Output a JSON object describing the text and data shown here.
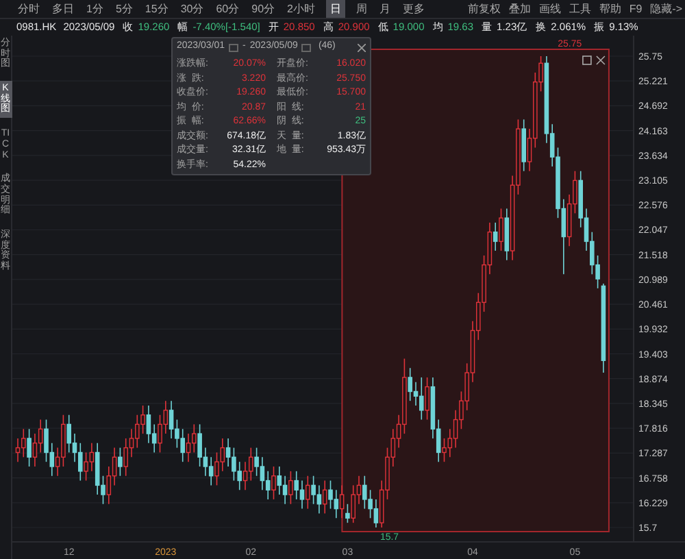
{
  "toolbar": {
    "periods": [
      {
        "label": "分时",
        "selected": false
      },
      {
        "label": "多日",
        "selected": false
      },
      {
        "label": "1分",
        "selected": false
      },
      {
        "label": "5分",
        "selected": false
      },
      {
        "label": "15分",
        "selected": false
      },
      {
        "label": "30分",
        "selected": false
      },
      {
        "label": "60分",
        "selected": false
      },
      {
        "label": "90分",
        "selected": false
      },
      {
        "label": "2小时",
        "selected": false
      },
      {
        "label": "日",
        "selected": true
      },
      {
        "label": "周",
        "selected": false
      },
      {
        "label": "月",
        "selected": false
      },
      {
        "label": "更多",
        "selected": false
      }
    ],
    "tools": [
      "前复权",
      "叠加",
      "画线",
      "工具",
      "帮助",
      "F9",
      "隐藏->"
    ]
  },
  "quote": {
    "code": "0981.HK",
    "date": "2023/05/09",
    "fields": [
      {
        "label": "收",
        "value": "19.260",
        "color": "#3fbf7f"
      },
      {
        "label": "幅",
        "value": "-7.40%[-1.540]",
        "color": "#3fbf7f"
      },
      {
        "label": "开",
        "value": "20.850",
        "color": "#e0333a"
      },
      {
        "label": "高",
        "value": "20.900",
        "color": "#e0333a"
      },
      {
        "label": "低",
        "value": "19.000",
        "color": "#3fbf7f"
      },
      {
        "label": "均",
        "value": "19.63",
        "color": "#3fbf7f"
      },
      {
        "label": "量",
        "value": "1.23亿",
        "color": "#e8e8e8"
      },
      {
        "label": "换",
        "value": "2.061%",
        "color": "#e8e8e8"
      },
      {
        "label": "振",
        "value": "9.13%",
        "color": "#e8e8e8"
      }
    ]
  },
  "sidebar": {
    "items": [
      {
        "label": "分时图",
        "selected": false
      },
      {
        "label": "K线图",
        "selected": true
      },
      {
        "label": "TICK",
        "selected": false
      },
      {
        "label": "成交明细",
        "selected": false
      },
      {
        "label": "深度资料",
        "selected": false
      }
    ]
  },
  "range_popup": {
    "start": "2023/03/01",
    "end": "2023/05/09",
    "separator": "-",
    "count": "(46)",
    "stats": [
      {
        "label": "涨跌幅:",
        "value": "20.07%",
        "color": "#e0333a"
      },
      {
        "label": "开盘价:",
        "value": "16.020",
        "color": "#e0333a"
      },
      {
        "label": "涨  跌:",
        "value": "3.220",
        "color": "#e0333a"
      },
      {
        "label": "最高价:",
        "value": "25.750",
        "color": "#e0333a"
      },
      {
        "label": "收盘价:",
        "value": "19.260",
        "color": "#e0333a"
      },
      {
        "label": "最低价:",
        "value": "15.700",
        "color": "#e0333a"
      },
      {
        "label": "均  价:",
        "value": "20.87",
        "color": "#e0333a"
      },
      {
        "label": "阳  线:",
        "value": "21",
        "color": "#e0333a"
      },
      {
        "label": "振  幅:",
        "value": "62.66%",
        "color": "#e0333a"
      },
      {
        "label": "阴  线:",
        "value": "25",
        "color": "#3fbf7f"
      },
      {
        "label": "成交额:",
        "value": "674.18亿",
        "color": "#f0f0f0"
      },
      {
        "label": "天  量:",
        "value": "1.83亿",
        "color": "#f0f0f0"
      },
      {
        "label": "成交量:",
        "value": "32.31亿",
        "color": "#f0f0f0"
      },
      {
        "label": "地  量:",
        "value": "953.43万",
        "color": "#f0f0f0"
      },
      {
        "label": "换手率:",
        "value": "54.22%",
        "color": "#f0f0f0"
      }
    ]
  },
  "chart": {
    "high_marker": "25.75",
    "low_marker": "15.7",
    "x_labels": [
      {
        "color": "#9a9a9a"
      },
      {
        "color": "#d9953a"
      },
      {
        "color": "#9a9a9a"
      },
      {
        "color": "#9a9a9a"
      },
      {
        "color": "#9a9a9a"
      },
      {
        "color": "#9a9a9a"
      }
    ],
    "chart_data": {
      "type": "candlestick",
      "grid": true,
      "ylim": [
        15.7,
        25.75
      ],
      "categories": [
        null,
        null,
        null,
        null,
        null,
        null,
        null,
        null,
        null,
        "12",
        null,
        null,
        null,
        null,
        null,
        null,
        null,
        null,
        null,
        null,
        null,
        null,
        null,
        null,
        null,
        null,
        "2023",
        null,
        null,
        null,
        null,
        null,
        null,
        null,
        null,
        null,
        null,
        null,
        null,
        null,
        null,
        "02",
        null,
        null,
        null,
        null,
        null,
        null,
        null,
        null,
        null,
        null,
        null,
        null,
        null,
        null,
        null,
        null,
        "03",
        null,
        null,
        null,
        null,
        null,
        null,
        null,
        null,
        null,
        null,
        null,
        null,
        null,
        null,
        null,
        null,
        null,
        null,
        null,
        null,
        null,
        "04",
        null,
        null,
        null,
        null,
        null,
        null,
        null,
        null,
        null,
        null,
        null,
        null,
        null,
        null,
        null,
        null,
        null,
        "05",
        null,
        null,
        null,
        null,
        null
      ],
      "yticks": [
        25.75,
        25.221,
        24.692,
        24.163,
        23.634,
        23.105,
        22.576,
        22.047,
        21.518,
        20.989,
        20.461,
        19.932,
        19.403,
        18.874,
        18.345,
        17.816,
        17.287,
        16.758,
        16.229,
        15.7
      ],
      "ohlc": [
        [
          17.3,
          17.6,
          17.1,
          17.4
        ],
        [
          17.4,
          17.8,
          17.2,
          17.6
        ],
        [
          17.6,
          17.8,
          17.0,
          17.2
        ],
        [
          17.2,
          17.7,
          17.0,
          17.5
        ],
        [
          17.5,
          18.0,
          17.3,
          17.8
        ],
        [
          17.8,
          18.0,
          17.1,
          17.3
        ],
        [
          17.3,
          17.5,
          16.8,
          17.0
        ],
        [
          17.0,
          17.4,
          16.8,
          17.2
        ],
        [
          17.2,
          18.1,
          17.0,
          17.9
        ],
        [
          17.9,
          18.1,
          17.3,
          17.5
        ],
        [
          17.5,
          17.7,
          17.1,
          17.3
        ],
        [
          17.3,
          17.5,
          16.7,
          16.9
        ],
        [
          16.9,
          17.3,
          16.7,
          17.1
        ],
        [
          17.1,
          17.5,
          16.9,
          17.3
        ],
        [
          17.3,
          17.5,
          16.4,
          16.6
        ],
        [
          16.6,
          16.8,
          16.2,
          16.4
        ],
        [
          16.4,
          17.0,
          16.2,
          16.8
        ],
        [
          16.8,
          17.4,
          16.6,
          17.2
        ],
        [
          17.2,
          17.4,
          16.8,
          17.0
        ],
        [
          17.0,
          17.6,
          16.8,
          17.4
        ],
        [
          17.4,
          17.8,
          17.2,
          17.6
        ],
        [
          17.6,
          18.1,
          17.4,
          17.9
        ],
        [
          17.9,
          18.3,
          17.7,
          18.1
        ],
        [
          18.1,
          18.3,
          17.5,
          17.7
        ],
        [
          17.7,
          17.9,
          17.3,
          17.5
        ],
        [
          17.5,
          18.1,
          17.3,
          17.9
        ],
        [
          17.9,
          18.4,
          17.7,
          18.2
        ],
        [
          18.2,
          18.4,
          17.6,
          17.8
        ],
        [
          17.8,
          18.0,
          17.4,
          17.6
        ],
        [
          17.6,
          17.8,
          17.1,
          17.3
        ],
        [
          17.3,
          17.7,
          17.1,
          17.5
        ],
        [
          17.5,
          17.9,
          17.3,
          17.7
        ],
        [
          17.7,
          17.9,
          17.0,
          17.2
        ],
        [
          17.2,
          17.4,
          16.8,
          17.0
        ],
        [
          17.0,
          17.2,
          16.6,
          16.8
        ],
        [
          16.8,
          17.3,
          16.6,
          17.1
        ],
        [
          17.1,
          17.6,
          16.9,
          17.4
        ],
        [
          17.4,
          17.6,
          17.0,
          17.2
        ],
        [
          17.2,
          17.4,
          16.7,
          16.9
        ],
        [
          16.9,
          17.1,
          16.5,
          16.7
        ],
        [
          16.7,
          17.1,
          16.5,
          16.9
        ],
        [
          16.9,
          17.4,
          16.7,
          17.2
        ],
        [
          17.2,
          17.4,
          16.8,
          17.0
        ],
        [
          17.0,
          17.2,
          16.5,
          16.7
        ],
        [
          16.7,
          16.9,
          16.3,
          16.5
        ],
        [
          16.5,
          17.0,
          16.3,
          16.8
        ],
        [
          16.8,
          17.0,
          16.4,
          16.6
        ],
        [
          16.6,
          16.8,
          16.2,
          16.4
        ],
        [
          16.4,
          16.9,
          16.2,
          16.7
        ],
        [
          16.7,
          16.9,
          16.3,
          16.5
        ],
        [
          16.5,
          16.7,
          16.1,
          16.3
        ],
        [
          16.3,
          16.8,
          16.1,
          16.6
        ],
        [
          16.6,
          16.8,
          16.2,
          16.4
        ],
        [
          16.4,
          16.6,
          16.0,
          16.2
        ],
        [
          16.2,
          16.7,
          16.0,
          16.5
        ],
        [
          16.5,
          16.7,
          16.1,
          16.3
        ],
        [
          16.3,
          16.5,
          15.9,
          16.1
        ],
        [
          16.1,
          16.6,
          15.9,
          16.4
        ],
        [
          16.0,
          16.2,
          15.8,
          15.9
        ],
        [
          15.9,
          16.6,
          15.8,
          16.4
        ],
        [
          16.4,
          16.8,
          16.2,
          16.6
        ],
        [
          16.6,
          16.8,
          16.1,
          16.3
        ],
        [
          16.3,
          16.5,
          15.9,
          16.1
        ],
        [
          16.1,
          16.3,
          15.7,
          15.8
        ],
        [
          15.8,
          16.7,
          15.7,
          16.5
        ],
        [
          16.5,
          17.4,
          16.3,
          17.2
        ],
        [
          17.2,
          17.8,
          17.0,
          17.6
        ],
        [
          17.6,
          18.1,
          17.4,
          17.9
        ],
        [
          17.9,
          19.3,
          17.7,
          18.9
        ],
        [
          18.9,
          19.1,
          18.4,
          18.6
        ],
        [
          18.6,
          18.8,
          18.3,
          18.5
        ],
        [
          18.5,
          18.9,
          18.0,
          18.2
        ],
        [
          18.2,
          18.9,
          18.0,
          18.7
        ],
        [
          18.7,
          18.9,
          17.6,
          17.8
        ],
        [
          17.8,
          18.0,
          17.1,
          17.3
        ],
        [
          17.3,
          17.6,
          17.1,
          17.4
        ],
        [
          17.4,
          17.8,
          17.2,
          17.6
        ],
        [
          17.6,
          18.2,
          17.4,
          18.0
        ],
        [
          18.0,
          18.6,
          17.8,
          18.4
        ],
        [
          18.4,
          19.2,
          18.2,
          19.0
        ],
        [
          19.0,
          20.1,
          18.8,
          19.9
        ],
        [
          19.9,
          20.7,
          19.7,
          20.5
        ],
        [
          20.5,
          21.5,
          20.3,
          21.3
        ],
        [
          21.3,
          22.2,
          21.1,
          22.0
        ],
        [
          22.0,
          22.2,
          21.6,
          21.8
        ],
        [
          21.8,
          22.5,
          21.6,
          22.3
        ],
        [
          22.3,
          22.5,
          21.4,
          21.6
        ],
        [
          21.6,
          23.2,
          21.4,
          23.0
        ],
        [
          23.0,
          24.4,
          22.8,
          24.2
        ],
        [
          24.2,
          24.4,
          23.3,
          23.5
        ],
        [
          23.5,
          24.2,
          23.3,
          24.0
        ],
        [
          24.0,
          25.4,
          23.8,
          25.2
        ],
        [
          25.2,
          25.75,
          25.0,
          25.6
        ],
        [
          25.6,
          25.75,
          23.9,
          24.1
        ],
        [
          24.1,
          24.3,
          23.4,
          23.6
        ],
        [
          23.6,
          23.8,
          22.3,
          22.5
        ],
        [
          22.5,
          22.7,
          21.1,
          21.9
        ],
        [
          21.9,
          22.8,
          21.7,
          22.6
        ],
        [
          22.6,
          23.3,
          22.4,
          23.1
        ],
        [
          23.1,
          23.3,
          22.1,
          22.3
        ],
        [
          22.3,
          22.5,
          21.6,
          21.8
        ],
        [
          21.8,
          22.0,
          21.1,
          21.3
        ],
        [
          21.3,
          21.5,
          20.8,
          21.0
        ],
        [
          20.85,
          20.9,
          19.0,
          19.26
        ]
      ]
    }
  }
}
